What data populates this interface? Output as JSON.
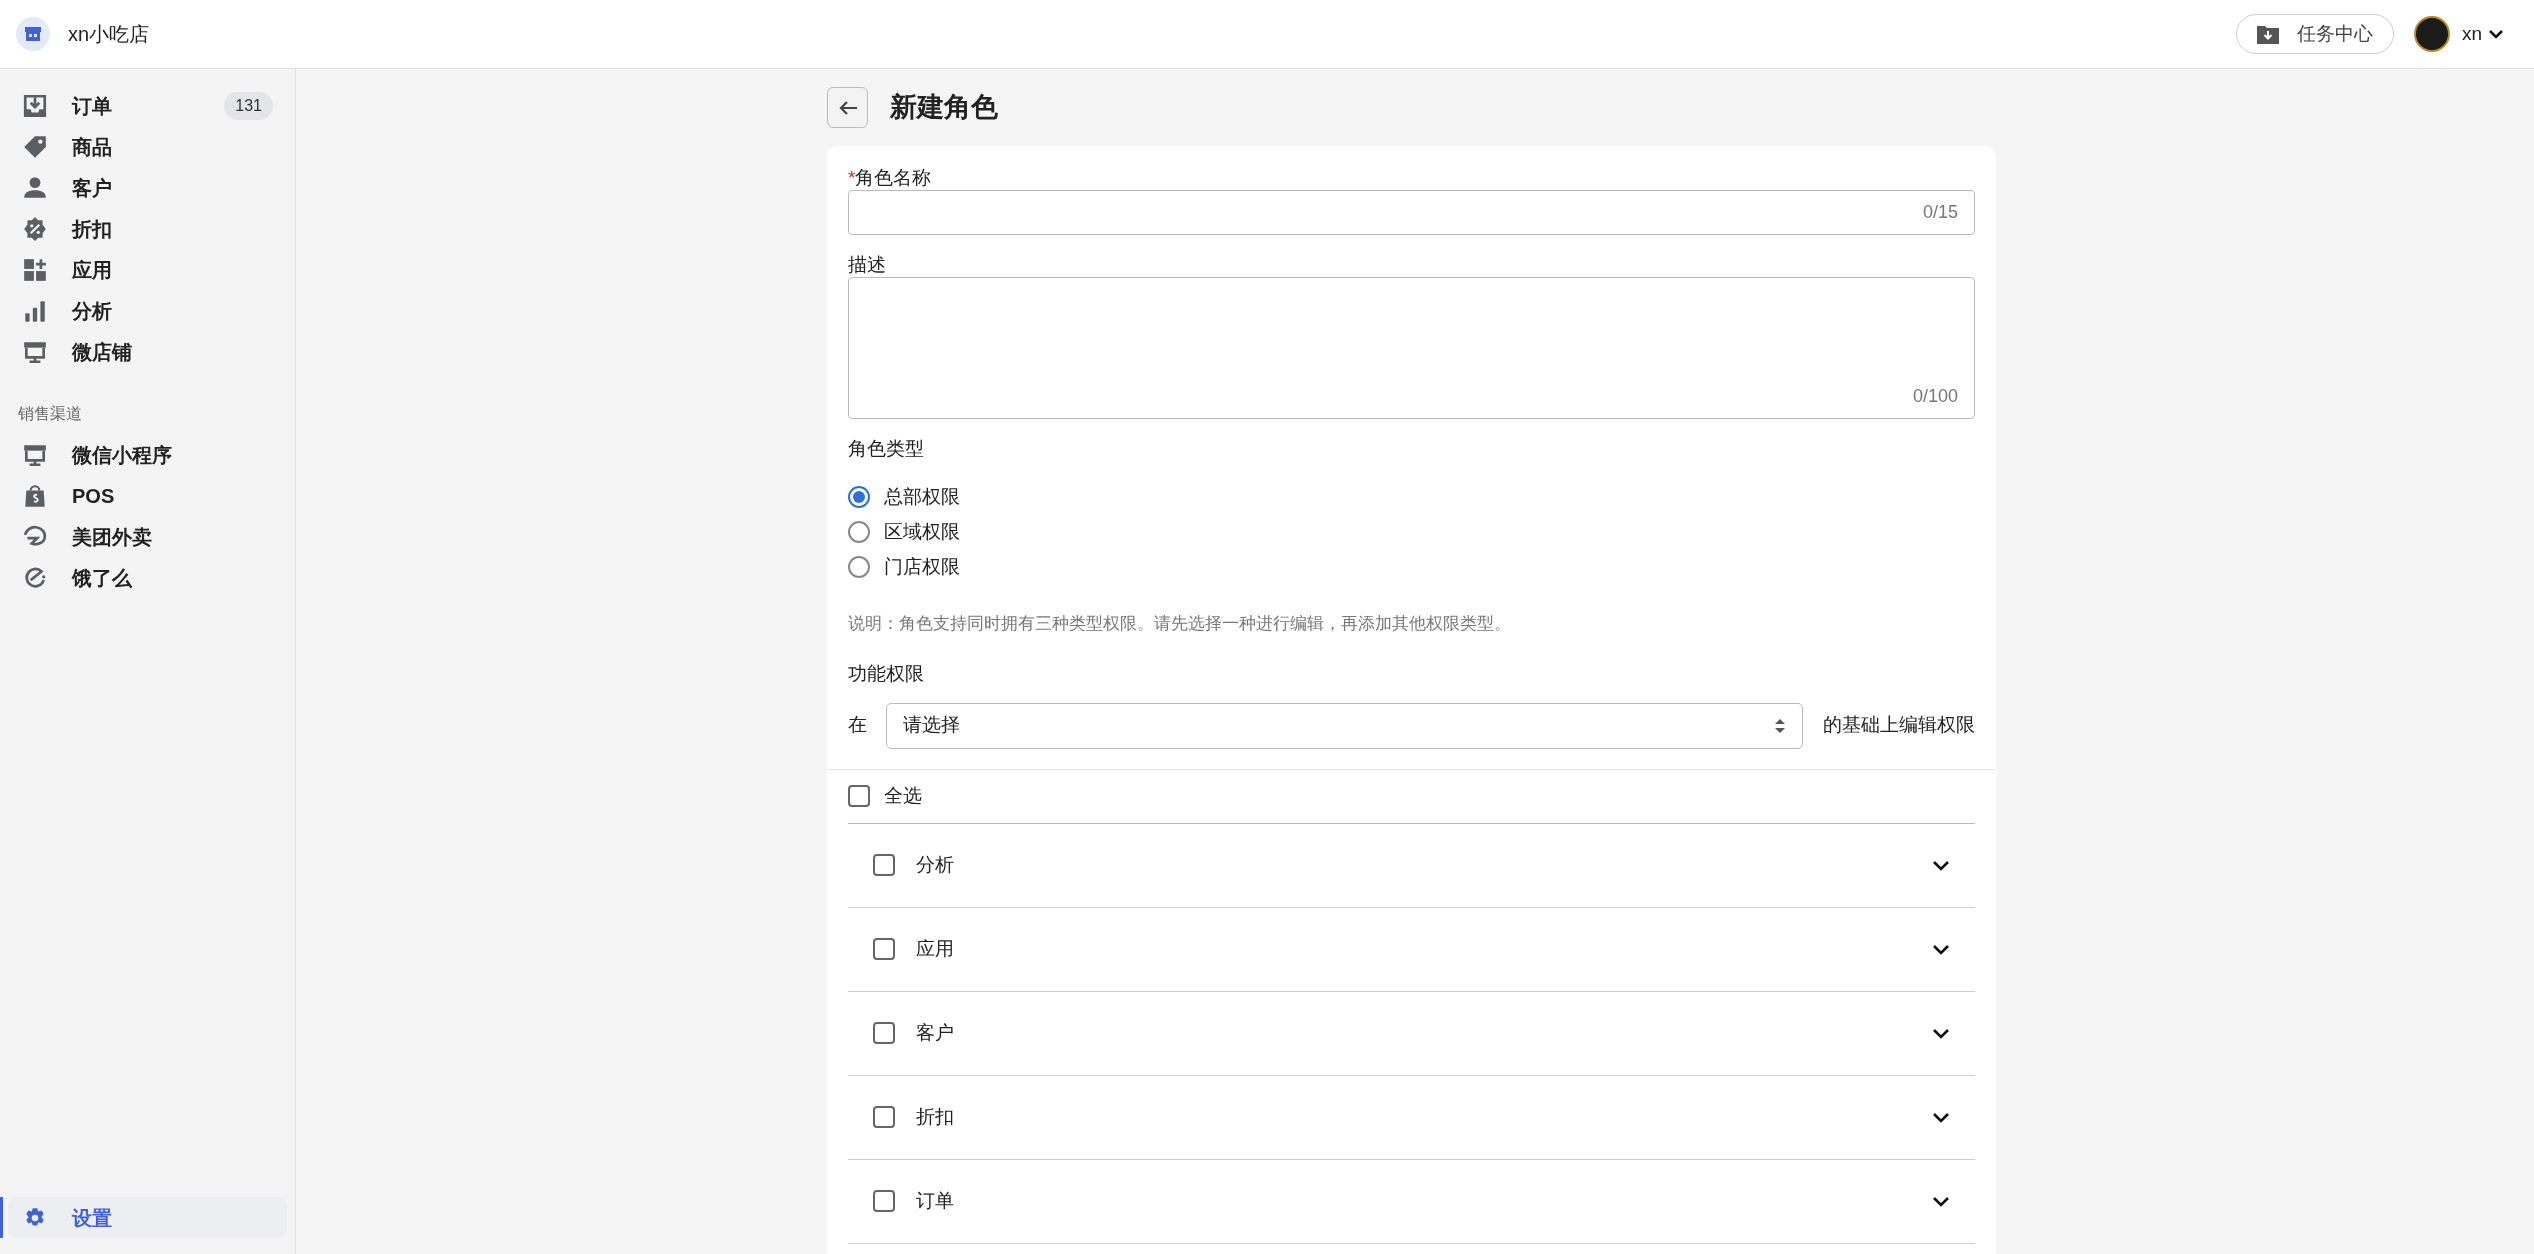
{
  "header": {
    "shop_name": "xn小吃店",
    "task_center": "任务中心",
    "user": "xn"
  },
  "sidebar": {
    "items": [
      {
        "label": "订单",
        "badge": "131",
        "selected": false
      },
      {
        "label": "商品",
        "selected": false
      },
      {
        "label": "客户",
        "selected": false
      },
      {
        "label": "折扣",
        "selected": false
      },
      {
        "label": "应用",
        "selected": false
      },
      {
        "label": "分析",
        "selected": false
      },
      {
        "label": "微店铺",
        "selected": false
      }
    ],
    "section_label": "销售渠道",
    "channels": [
      {
        "label": "微信小程序",
        "selected": false
      },
      {
        "label": "POS",
        "selected": false
      },
      {
        "label": "美团外卖",
        "selected": false
      },
      {
        "label": "饿了么",
        "selected": false
      }
    ],
    "settings": {
      "label": "设置",
      "selected": true
    }
  },
  "page": {
    "title": "新建角色",
    "fields": [
      {
        "kind": "input",
        "label": "角色名称",
        "required_mark": "*",
        "counter": "0/15"
      },
      {
        "kind": "textarea",
        "label": "描述",
        "counter": "0/100"
      }
    ],
    "role_type": {
      "label": "角色类型",
      "options": [
        {
          "label": "总部权限",
          "selected": true
        },
        {
          "label": "区域权限",
          "selected": false
        },
        {
          "label": "门店权限",
          "selected": false
        }
      ]
    },
    "note": "说明：角色支持同时拥有三种类型权限。请先选择一种进行编辑，再添加其他权限类型。",
    "function_permissions": {
      "label": "功能权限",
      "prefix": "在",
      "placeholder": "请选择",
      "suffix": "的基础上编辑权限"
    },
    "select_all": {
      "label": "全选",
      "checked": false
    },
    "modules": [
      {
        "label": "分析",
        "checked": false,
        "expanded": false
      },
      {
        "label": "应用",
        "checked": false,
        "expanded": false
      },
      {
        "label": "客户",
        "checked": false,
        "expanded": false
      },
      {
        "label": "折扣",
        "checked": false,
        "expanded": false
      },
      {
        "label": "订单",
        "checked": false,
        "expanded": false
      }
    ]
  }
}
